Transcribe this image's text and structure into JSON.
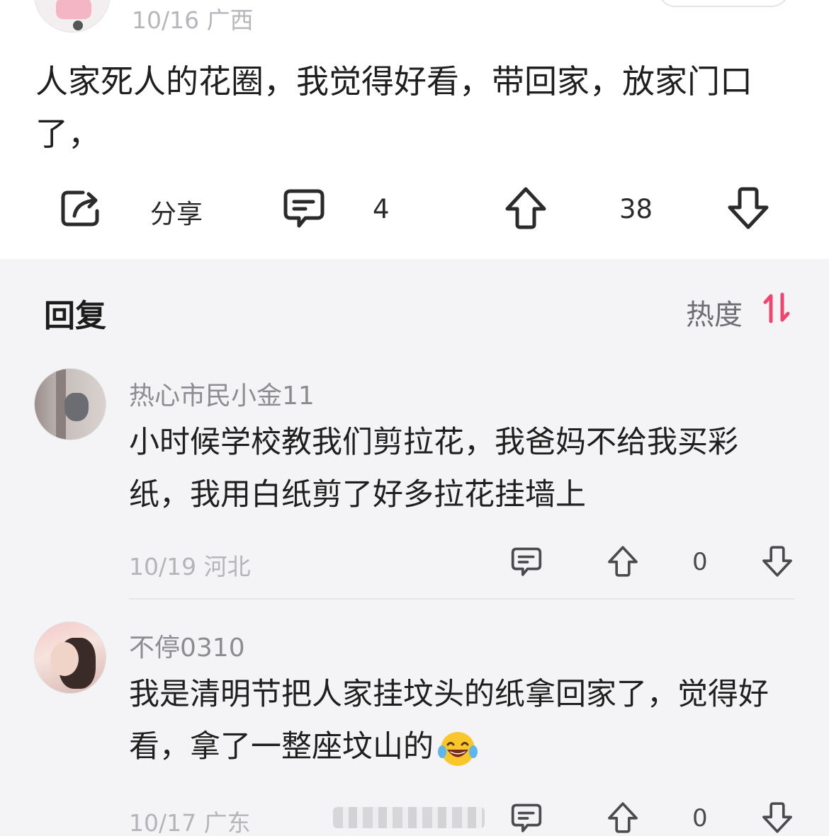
{
  "post": {
    "meta": "10/16 广西",
    "content": "人家死人的花圈，我觉得好看，带回家，放家门口了，",
    "actions": {
      "share_label": "分享",
      "comment_count": "4",
      "upvote_count": "38"
    }
  },
  "replies": {
    "title": "回复",
    "sort_label": "热度",
    "items": [
      {
        "username": "热心市民小金11",
        "text": "小时候学校教我们剪拉花，我爸妈不给我买彩纸，我用白纸剪了好多拉花挂墙上",
        "meta": "10/19 河北",
        "vote_count": "0"
      },
      {
        "username": "不停0310",
        "text": "我是清明节把人家挂坟头的纸拿回家了，觉得好看，拿了一整座坟山的",
        "emoji": "laughing-crying-emoji",
        "meta": "10/17 广东",
        "vote_count": "0"
      }
    ]
  },
  "colors": {
    "accent": "#f0466e",
    "muted": "#b4b4ba",
    "panel": "#f4f4f6"
  }
}
